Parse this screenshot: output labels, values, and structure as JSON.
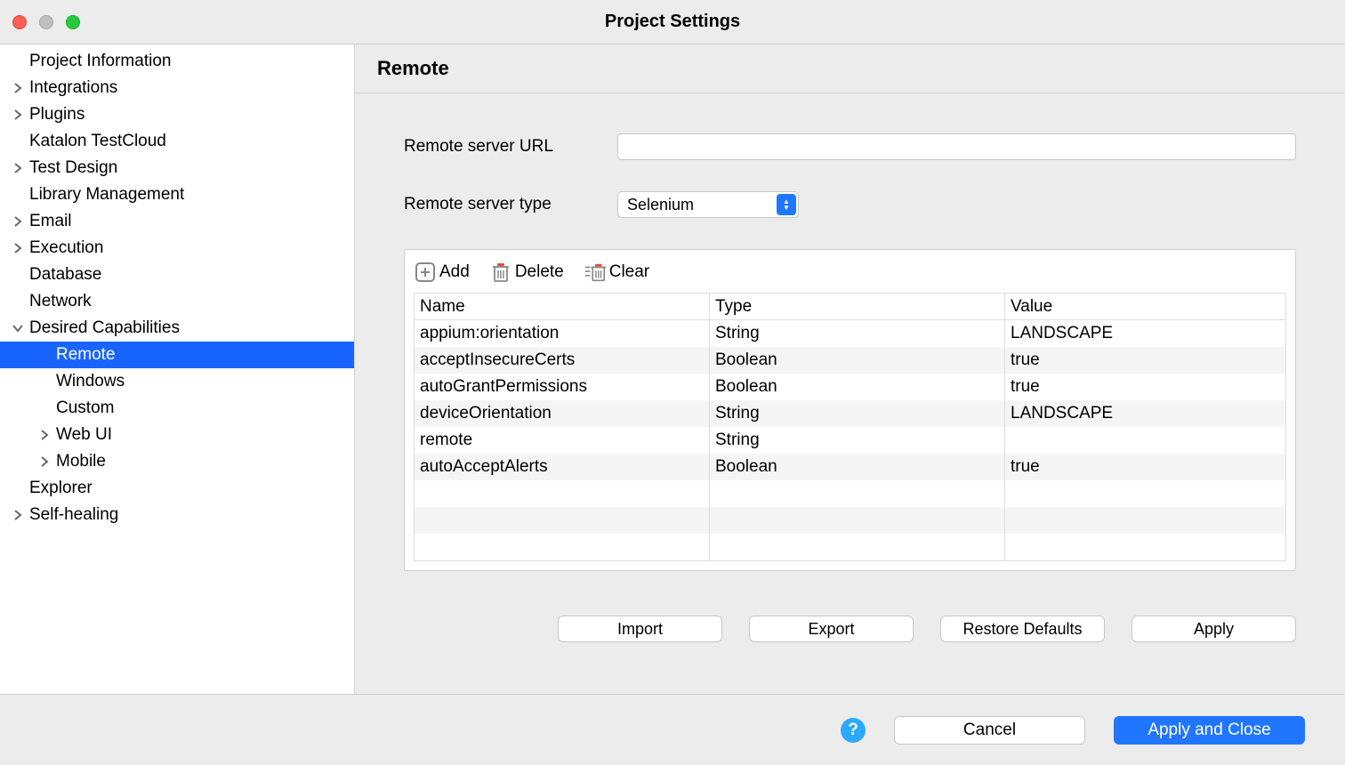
{
  "window": {
    "title": "Project Settings"
  },
  "sidebar": {
    "items": [
      {
        "label": "Project Information",
        "indent": 1,
        "arrow": "none"
      },
      {
        "label": "Integrations",
        "indent": 1,
        "arrow": "right"
      },
      {
        "label": "Plugins",
        "indent": 1,
        "arrow": "right"
      },
      {
        "label": "Katalon TestCloud",
        "indent": 1,
        "arrow": "none"
      },
      {
        "label": "Test Design",
        "indent": 1,
        "arrow": "right"
      },
      {
        "label": "Library Management",
        "indent": 1,
        "arrow": "none"
      },
      {
        "label": "Email",
        "indent": 1,
        "arrow": "right"
      },
      {
        "label": "Execution",
        "indent": 1,
        "arrow": "right"
      },
      {
        "label": "Database",
        "indent": 1,
        "arrow": "none"
      },
      {
        "label": "Network",
        "indent": 1,
        "arrow": "none"
      },
      {
        "label": "Desired Capabilities",
        "indent": 1,
        "arrow": "down"
      },
      {
        "label": "Remote",
        "indent": 2,
        "arrow": "none",
        "selected": true
      },
      {
        "label": "Windows",
        "indent": 2,
        "arrow": "none"
      },
      {
        "label": "Custom",
        "indent": 2,
        "arrow": "none"
      },
      {
        "label": "Web UI",
        "indent": 2,
        "arrow": "right"
      },
      {
        "label": "Mobile",
        "indent": 2,
        "arrow": "right"
      },
      {
        "label": "Explorer",
        "indent": 1,
        "arrow": "none"
      },
      {
        "label": "Self-healing",
        "indent": 1,
        "arrow": "right"
      }
    ]
  },
  "content": {
    "header": "Remote",
    "form": {
      "url_label": "Remote server URL",
      "url_value": "",
      "type_label": "Remote server type",
      "type_value": "Selenium"
    },
    "toolbar": {
      "add": "Add",
      "delete": "Delete",
      "clear": "Clear"
    },
    "table": {
      "headers": {
        "name": "Name",
        "type": "Type",
        "value": "Value"
      },
      "rows": [
        {
          "name": "appium:orientation",
          "type": "String",
          "value": "LANDSCAPE"
        },
        {
          "name": "acceptInsecureCerts",
          "type": "Boolean",
          "value": "true"
        },
        {
          "name": "autoGrantPermissions",
          "type": "Boolean",
          "value": "true"
        },
        {
          "name": "deviceOrientation",
          "type": "String",
          "value": "LANDSCAPE"
        },
        {
          "name": "remote",
          "type": "String",
          "value": ""
        },
        {
          "name": "autoAcceptAlerts",
          "type": "Boolean",
          "value": "true"
        }
      ],
      "empty_rows": 3
    },
    "buttons": {
      "import": "Import",
      "export": "Export",
      "restore": "Restore Defaults",
      "apply": "Apply"
    }
  },
  "footer": {
    "cancel": "Cancel",
    "apply_close": "Apply and Close"
  }
}
